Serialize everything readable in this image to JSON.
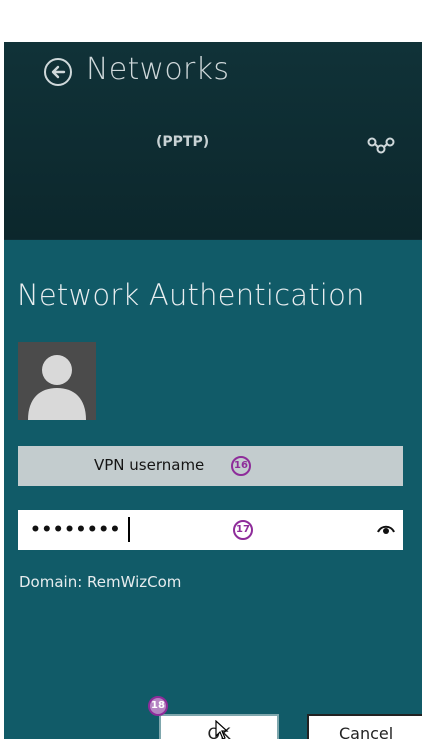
{
  "header": {
    "title": "Networks",
    "back_icon": "back-arrow-icon",
    "connection_type": "(PPTP)",
    "status_icon": "connected-icon"
  },
  "dialog": {
    "title": "Network Authentication",
    "avatar_icon": "user-avatar-icon",
    "username_value": "VPN username",
    "password_value": "••••••••",
    "password_reveal_icon": "eye-icon",
    "domain_text": "Domain: RemWizCom",
    "ok_label": "OK",
    "cancel_label": "Cancel"
  },
  "annotations": {
    "step_16": "16",
    "step_17": "17",
    "step_18": "18"
  },
  "colors": {
    "header_bg": "#0f2d33",
    "dialog_bg": "#115b68",
    "annotation": "#8e2c9a"
  }
}
